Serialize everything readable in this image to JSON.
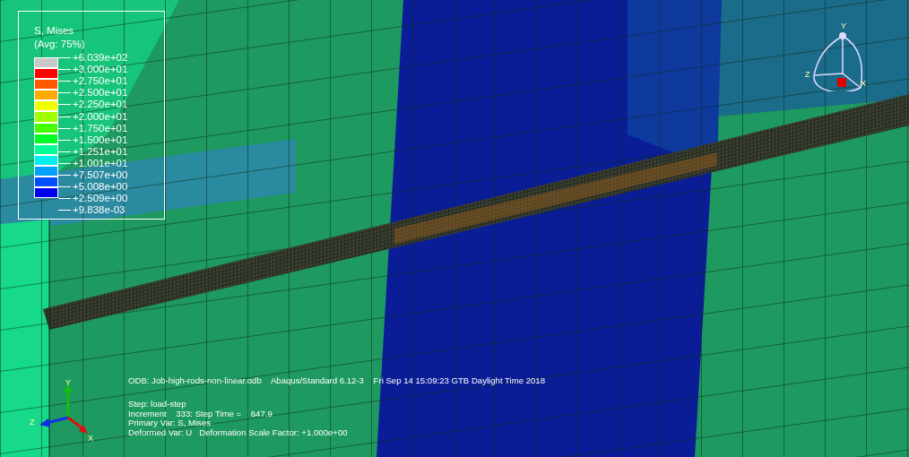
{
  "legend": {
    "title": "S, Mises",
    "subtitle": "(Avg: 75%)",
    "bands": [
      {
        "color": "#c8c8c8"
      },
      {
        "color": "#ff0000"
      },
      {
        "color": "#ff5a00"
      },
      {
        "color": "#ffaa00"
      },
      {
        "color": "#f0ff00"
      },
      {
        "color": "#a0ff00"
      },
      {
        "color": "#46ff00"
      },
      {
        "color": "#00ff28"
      },
      {
        "color": "#00ff96"
      },
      {
        "color": "#00f0f0"
      },
      {
        "color": "#00a0ff"
      },
      {
        "color": "#0050ff"
      },
      {
        "color": "#0000f0"
      }
    ],
    "labels": [
      "+6.039e+02",
      "+3.000e+01",
      "+2.750e+01",
      "+2.500e+01",
      "+2.250e+01",
      "+2.000e+01",
      "+1.750e+01",
      "+1.500e+01",
      "+1.251e+01",
      "+1.001e+01",
      "+7.507e+00",
      "+5.008e+00",
      "+2.509e+00",
      "+9.838e-03"
    ]
  },
  "view_triad": {
    "axes": [
      "Y",
      "Z",
      "X"
    ]
  },
  "axis_triad": {
    "axes": [
      "Y",
      "Z",
      "X"
    ]
  },
  "info": {
    "header": "ODB: Job-high-rods-non-linear.odb    Abaqus/Standard 6.12-3    Fri Sep 14 15:09:23 GTB Daylight Time 2018",
    "lines": [
      "Step: load-step",
      "Increment    333: Step Time =    647.9",
      "Primary Var: S, Mises",
      "Deformed Var: U   Deformation Scale Factor: +1.000e+00"
    ]
  }
}
